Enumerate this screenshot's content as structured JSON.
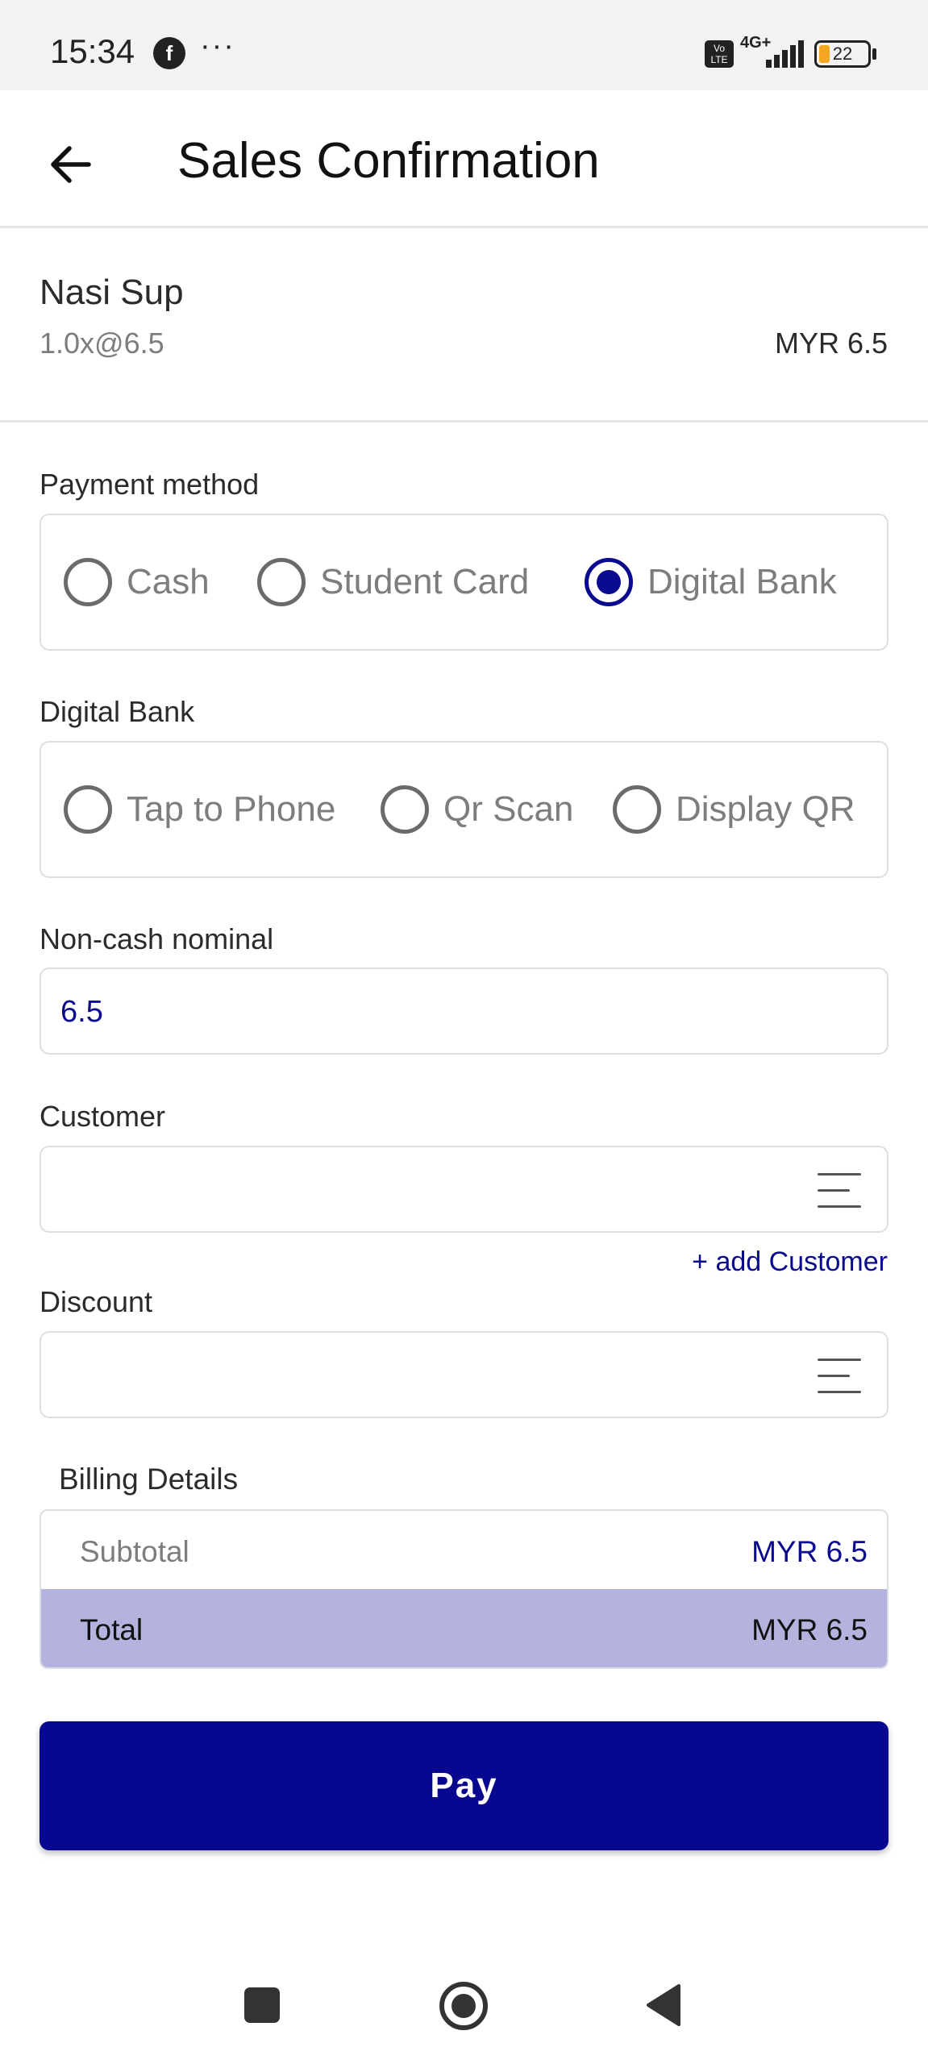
{
  "status_bar": {
    "time": "15:34",
    "app_icon_letter": "f",
    "more": "···",
    "volte": "Vo\nLTE",
    "network": "4G+",
    "battery": "22",
    "battery_fraction": 0.22
  },
  "header": {
    "title": "Sales Confirmation",
    "back_icon": "arrow-left-icon"
  },
  "order_item": {
    "name": "Nasi Sup",
    "quantity_price": "1.0x@6.5",
    "amount": "MYR 6.5"
  },
  "payment_method": {
    "label": "Payment method",
    "options": [
      "Cash",
      "Student Card",
      "Digital Bank"
    ],
    "selected": "Digital Bank"
  },
  "digital_bank": {
    "label": "Digital Bank",
    "options": [
      "Tap to Phone",
      "Qr Scan",
      "Display QR"
    ],
    "selected": null
  },
  "non_cash_nominal": {
    "label": "Non-cash nominal",
    "value": "6.5"
  },
  "customer": {
    "label": "Customer",
    "value": "",
    "menu_icon": "list-menu-icon",
    "add_link": "+ add Customer"
  },
  "discount": {
    "label": "Discount",
    "value": "",
    "menu_icon": "list-menu-icon"
  },
  "billing": {
    "title": "Billing Details",
    "subtotal_label": "Subtotal",
    "subtotal_value": "MYR 6.5",
    "total_label": "Total",
    "total_value": "MYR 6.5"
  },
  "actions": {
    "pay_label": "Pay"
  },
  "colors": {
    "primary": "#07078F",
    "total_row_bg": "#B3B3DE",
    "muted_text": "#7D7D7D",
    "border": "#DCDEE3"
  },
  "system_nav": {
    "recents_icon": "square-recents-icon",
    "home_icon": "circle-home-icon",
    "back_icon": "triangle-back-icon"
  }
}
